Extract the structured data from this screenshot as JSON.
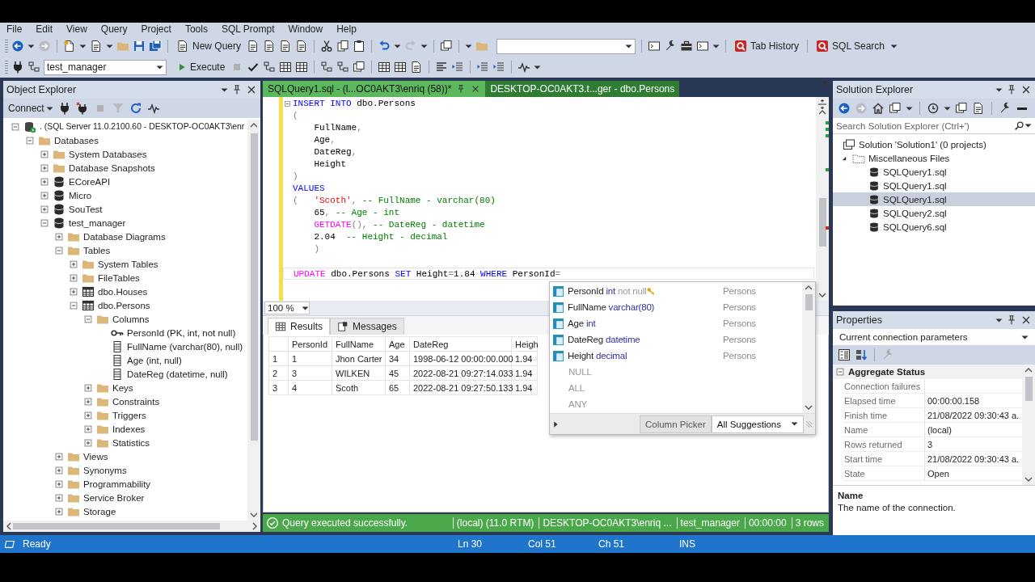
{
  "menu": [
    "File",
    "Edit",
    "View",
    "Query",
    "Project",
    "Tools",
    "SQL Prompt",
    "Window",
    "Help"
  ],
  "toolbar": {
    "new_query": "New Query",
    "tab_history": "Tab History",
    "sql_search": "SQL Search",
    "database": "test_manager",
    "execute": "Execute"
  },
  "object_explorer": {
    "title": "Object Explorer",
    "connect": "Connect",
    "tree": [
      {
        "label": ". (SQL Server 11.0.2100.60 - DESKTOP-OC0AKT3\\enr",
        "kind": "server",
        "expanded": true,
        "children": [
          {
            "label": "Databases",
            "kind": "folder",
            "expanded": true,
            "children": [
              {
                "label": "System Databases",
                "kind": "folder",
                "expanded": false
              },
              {
                "label": "Database Snapshots",
                "kind": "folder",
                "expanded": false
              },
              {
                "label": "ECoreAPI",
                "kind": "database",
                "expanded": false
              },
              {
                "label": "Micro",
                "kind": "database",
                "expanded": false
              },
              {
                "label": "SouTest",
                "kind": "database",
                "expanded": false
              },
              {
                "label": "test_manager",
                "kind": "database",
                "expanded": true,
                "children": [
                  {
                    "label": "Database Diagrams",
                    "kind": "folder",
                    "expanded": false
                  },
                  {
                    "label": "Tables",
                    "kind": "folder",
                    "expanded": true,
                    "children": [
                      {
                        "label": "System Tables",
                        "kind": "folder",
                        "expanded": false
                      },
                      {
                        "label": "FileTables",
                        "kind": "folder",
                        "expanded": false
                      },
                      {
                        "label": "dbo.Houses",
                        "kind": "table",
                        "expanded": false
                      },
                      {
                        "label": "dbo.Persons",
                        "kind": "table",
                        "expanded": true,
                        "children": [
                          {
                            "label": "Columns",
                            "kind": "folder",
                            "expanded": true,
                            "children": [
                              {
                                "label": "PersonId (PK, int, not null)",
                                "kind": "key"
                              },
                              {
                                "label": "FullName (varchar(80), null)",
                                "kind": "column"
                              },
                              {
                                "label": "Age (int, null)",
                                "kind": "column"
                              },
                              {
                                "label": "DateReg (datetime, null)",
                                "kind": "column"
                              }
                            ]
                          },
                          {
                            "label": "Keys",
                            "kind": "folder",
                            "expanded": false
                          },
                          {
                            "label": "Constraints",
                            "kind": "folder",
                            "expanded": false
                          },
                          {
                            "label": "Triggers",
                            "kind": "folder",
                            "expanded": false
                          },
                          {
                            "label": "Indexes",
                            "kind": "folder",
                            "expanded": false
                          },
                          {
                            "label": "Statistics",
                            "kind": "folder",
                            "expanded": false
                          }
                        ]
                      }
                    ]
                  },
                  {
                    "label": "Views",
                    "kind": "folder",
                    "expanded": false
                  },
                  {
                    "label": "Synonyms",
                    "kind": "folder",
                    "expanded": false
                  },
                  {
                    "label": "Programmability",
                    "kind": "folder",
                    "expanded": false
                  },
                  {
                    "label": "Service Broker",
                    "kind": "folder",
                    "expanded": false
                  },
                  {
                    "label": "Storage",
                    "kind": "folder",
                    "expanded": false
                  }
                ]
              }
            ]
          }
        ]
      }
    ]
  },
  "editor": {
    "tabs": [
      {
        "label": "SQLQuery1.sql - (l...OC0AKT3\\enriq (58))*",
        "selected": true
      },
      {
        "label": "DESKTOP-OC0AKT3.t...ger - dbo.Persons",
        "selected": false
      }
    ],
    "lines": [
      {
        "tokens": [
          {
            "kind": "keyword",
            "text": "INSERT INTO"
          },
          {
            "kind": "plain",
            "text": " dbo.Persons"
          }
        ]
      },
      {
        "tokens": [
          {
            "kind": "punct",
            "text": "("
          }
        ]
      },
      {
        "tokens": [
          {
            "kind": "plain",
            "text": "    FullName"
          },
          {
            "kind": "punct",
            "text": ","
          }
        ]
      },
      {
        "tokens": [
          {
            "kind": "plain",
            "text": "    Age"
          },
          {
            "kind": "punct",
            "text": ","
          }
        ]
      },
      {
        "tokens": [
          {
            "kind": "plain",
            "text": "    DateReg"
          },
          {
            "kind": "punct",
            "text": ","
          }
        ]
      },
      {
        "tokens": [
          {
            "kind": "plain",
            "text": "    Height"
          }
        ]
      },
      {
        "tokens": [
          {
            "kind": "punct",
            "text": ")"
          }
        ]
      },
      {
        "tokens": [
          {
            "kind": "keyword",
            "text": "VALUES"
          }
        ]
      },
      {
        "tokens": [
          {
            "kind": "punct",
            "text": "(   "
          },
          {
            "kind": "string",
            "text": "'Scoth'"
          },
          {
            "kind": "punct",
            "text": ","
          },
          {
            "kind": "comment",
            "text": " -- FullName - varchar(80)"
          }
        ]
      },
      {
        "tokens": [
          {
            "kind": "plain",
            "text": "    65"
          },
          {
            "kind": "punct",
            "text": ","
          },
          {
            "kind": "comment",
            "text": " -- Age - int"
          }
        ]
      },
      {
        "tokens": [
          {
            "kind": "function",
            "text": "    GETDATE"
          },
          {
            "kind": "punct",
            "text": "(),"
          },
          {
            "kind": "comment",
            "text": " -- DateReg - datetime"
          }
        ]
      },
      {
        "tokens": [
          {
            "kind": "plain",
            "text": "    2.04  "
          },
          {
            "kind": "comment",
            "text": "-- Height - decimal"
          }
        ]
      },
      {
        "tokens": [
          {
            "kind": "punct",
            "text": "    )"
          }
        ]
      },
      {
        "current": true,
        "tokens": [
          {
            "kind": "function",
            "text": "UPDATE"
          },
          {
            "kind": "plain",
            "text": " dbo.Persons "
          },
          {
            "kind": "keyword",
            "text": "SET"
          },
          {
            "kind": "plain",
            "text": " Height"
          },
          {
            "kind": "punct",
            "text": "="
          },
          {
            "kind": "plain",
            "text": "1.84 "
          },
          {
            "kind": "keyword",
            "text": "WHERE"
          },
          {
            "kind": "plain",
            "text": " PersonId"
          },
          {
            "kind": "punct",
            "text": "="
          }
        ]
      }
    ],
    "zoom": "100 %",
    "results_tabs": [
      {
        "label": "Results",
        "selected": true
      },
      {
        "label": "Messages",
        "selected": false
      }
    ],
    "columns": [
      "PersonId",
      "FullName",
      "Age",
      "DateReg",
      "Heigh"
    ],
    "rows": [
      {
        "number": "1",
        "cells": [
          "1",
          "Jhon Carter",
          "34",
          "1998-06-12 00:00:00.000",
          "1.94"
        ]
      },
      {
        "number": "2",
        "cells": [
          "3",
          "WILKEN",
          "45",
          "2022-08-21 09:27:14.033",
          "1.94"
        ]
      },
      {
        "number": "3",
        "cells": [
          "4",
          "Scoth",
          "65",
          "2022-08-21 09:27:50.133",
          "1.94"
        ]
      }
    ],
    "suggestions": [
      {
        "kind": "column",
        "name": "PersonId",
        "type": "int",
        "note": "not null",
        "key": true,
        "source": "Persons"
      },
      {
        "kind": "column",
        "name": "FullName",
        "type": "varchar(80)",
        "key": false,
        "source": "Persons"
      },
      {
        "kind": "column",
        "name": "Age",
        "type": "int",
        "key": false,
        "source": "Persons"
      },
      {
        "kind": "column",
        "name": "DateReg",
        "type": "datetime",
        "key": false,
        "source": "Persons"
      },
      {
        "kind": "column",
        "name": "Height",
        "type": "decimal",
        "key": false,
        "source": "Persons"
      },
      {
        "kind": "keyword",
        "name": "NULL"
      },
      {
        "kind": "keyword",
        "name": "ALL"
      },
      {
        "kind": "keyword",
        "name": "ANY"
      }
    ],
    "suggestion_tabs": [
      {
        "label": "Column Picker",
        "selected": false
      },
      {
        "label": "All Suggestions",
        "selected": true
      }
    ],
    "status": {
      "message": "Query executed successfully.",
      "segments": [
        "(local) (11.0 RTM)",
        "DESKTOP-OC0AKT3\\enriq ...",
        "test_manager",
        "00:00:00",
        "3 rows"
      ]
    }
  },
  "solution_explorer": {
    "title": "Solution Explorer",
    "search_placeholder": "Search Solution Explorer (Ctrl+')",
    "solution": "Solution 'Solution1' (0 projects)",
    "folder": {
      "label": "Miscellaneous Files",
      "expanded": true
    },
    "files": [
      {
        "label": "SQLQuery1.sql",
        "selected": false
      },
      {
        "label": "SQLQuery1.sql",
        "selected": false
      },
      {
        "label": "SQLQuery1.sql",
        "selected": true
      },
      {
        "label": "SQLQuery2.sql",
        "selected": false
      },
      {
        "label": "SQLQuery6.sql",
        "selected": false
      }
    ]
  },
  "properties": {
    "title": "Properties",
    "object": "Current connection parameters",
    "category": {
      "label": "Aggregate Status",
      "expanded": true
    },
    "rows": [
      {
        "name": "Connection failures"
      },
      {
        "name": "Elapsed time",
        "value": "00:00:00.158"
      },
      {
        "name": "Finish time",
        "value": "21/08/2022 09:30:43 a."
      },
      {
        "name": "Name",
        "value": "(local)"
      },
      {
        "name": "Rows returned",
        "value": "3"
      },
      {
        "name": "Start time",
        "value": "21/08/2022 09:30:43 a."
      },
      {
        "name": "State",
        "value": "Open"
      }
    ],
    "description": {
      "title": "Name",
      "text": "The name of the connection."
    }
  },
  "status_bar": {
    "text": "Ready",
    "line": "Ln 30",
    "col": "Col 51",
    "ch": "Ch 51",
    "mode": "INS"
  }
}
